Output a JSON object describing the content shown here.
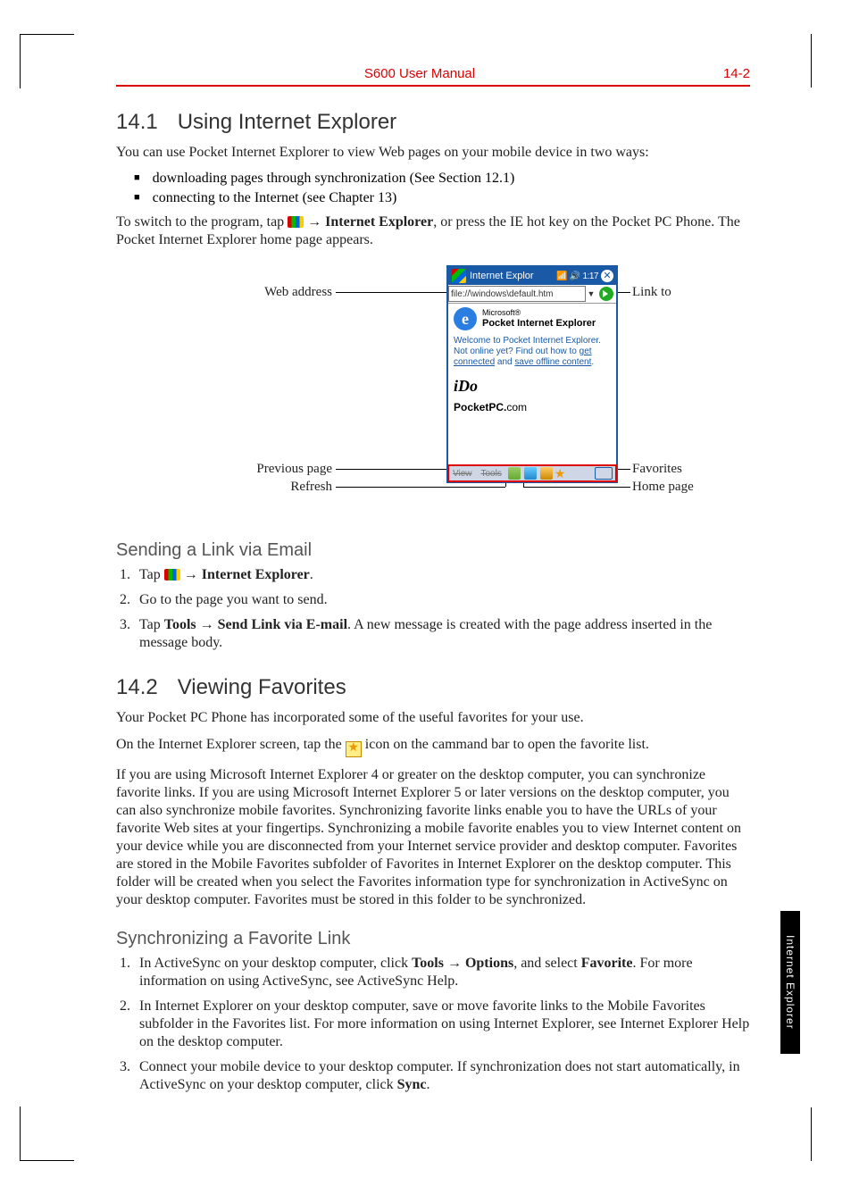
{
  "header": {
    "doc_title": "S600 User Manual",
    "page_label": "14-2"
  },
  "side_tab": "Internet Explorer",
  "s141": {
    "num": "14.1",
    "title": "Using Internet Explorer",
    "intro": "You can use Pocket Internet Explorer to view Web pages on your mobile device in two ways:",
    "bullets": [
      "downloading pages through synchronization (See Section 12.1)",
      "connecting to the Internet (see Chapter 13)"
    ],
    "switch_pre": "To switch to the program, tap ",
    "switch_arrow": " → ",
    "switch_bold": "Internet Explorer",
    "switch_post": ", or press the IE hot key on the Pocket PC Phone. The Pocket Internet Explorer home page appears."
  },
  "fig": {
    "titlebar_text": "Internet Explor",
    "status_text": "1:17",
    "address_value": "file://\\windows\\default.htm",
    "brand_small": "Microsoft®",
    "brand_big": "Pocket Internet Explorer",
    "welcome_l1": "Welcome to Pocket Internet Explorer.",
    "welcome_l2a": "Not online yet? Find out how to ",
    "welcome_link1": "get connected",
    "welcome_l2b": " and ",
    "welcome_link2": "save offline content",
    "welcome_l2c": ".",
    "ido": "iDo",
    "pcom_bold": "PocketPC.",
    "pcom_rest": "com",
    "bb_view": "View",
    "bb_tools": "Tools",
    "callouts": {
      "web_address": "Web address",
      "link_to": "Link to",
      "previous_page": "Previous page",
      "refresh": "Refresh",
      "favorites": "Favorites",
      "home_page": "Home page"
    }
  },
  "send_link": {
    "heading": "Sending a Link via Email",
    "step1_pre": "Tap ",
    "step1_arrow": " → ",
    "step1_bold": "Internet Explorer",
    "step1_post": ".",
    "step2": "Go to the page you want to send.",
    "step3_pre": "Tap ",
    "step3_b1": "Tools",
    "step3_arrow": " → ",
    "step3_b2": "Send Link via E-mail",
    "step3_post": ". A new message is created with the page address inserted in the message body."
  },
  "s142": {
    "num": "14.2",
    "title": "Viewing Favorites",
    "p1": "Your Pocket PC Phone has incorporated some of the useful favorites for your use.",
    "p2_pre": "On the Internet Explorer screen, tap the ",
    "p2_post": " icon on the cammand bar to open the favorite list.",
    "p3": "If you are using Microsoft Internet Explorer 4 or greater on the desktop computer, you can synchronize favorite links. If you are using Microsoft Internet Explorer 5 or later versions on the desktop computer, you can also synchronize mobile favorites. Synchronizing favorite links enable you to have the URLs of your favorite Web sites at your fingertips. Synchronizing a mobile favorite enables you to view Internet content on your device while you are disconnected from your Internet service provider and desktop computer. Favorites are stored in the Mobile Favorites subfolder of Favorites in Internet Explorer on the desktop computer. This folder will be created when you select the Favorites information type for synchronization in ActiveSync on your desktop computer. Favorites must be stored in this folder to be synchronized."
  },
  "sync": {
    "heading": "Synchronizing a Favorite Link",
    "s1_pre": "In ActiveSync on your desktop computer, click ",
    "s1_b1": "Tools",
    "s1_arrow": " → ",
    "s1_b2": "Options",
    "s1_mid": ", and select ",
    "s1_b3": "Favorite",
    "s1_post": ". For more information on using ActiveSync, see ActiveSync Help.",
    "s2": "In Internet Explorer on your desktop computer, save or move favorite links to the Mobile Favorites subfolder in the Favorites list. For more information on using Internet Explorer, see Internet Explorer Help on the desktop computer.",
    "s3_pre": "Connect your mobile device to your desktop computer. If synchronization does not start automatically, in ActiveSync on your desktop computer, click ",
    "s3_b": "Sync",
    "s3_post": "."
  }
}
